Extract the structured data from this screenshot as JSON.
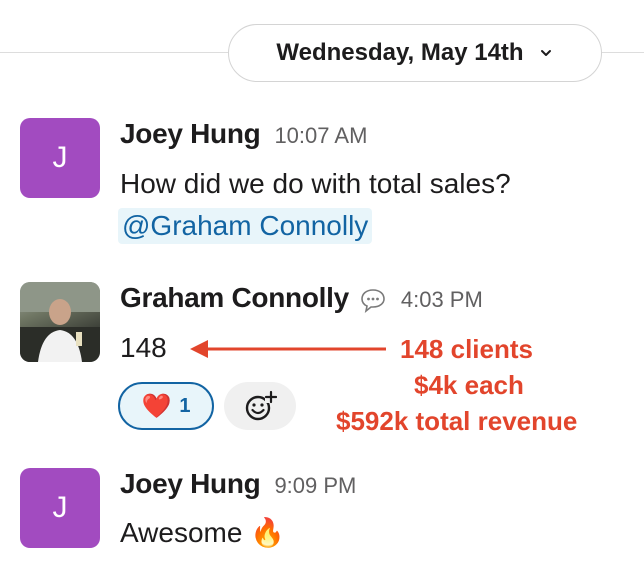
{
  "date_divider": {
    "label": "Wednesday, May 14th"
  },
  "messages": [
    {
      "sender": "Joey Hung",
      "time": "10:07 AM",
      "avatar_initial": "J",
      "text": "How did we do with total sales?",
      "mention": "@Graham Connolly"
    },
    {
      "sender": "Graham Connolly",
      "time": "4:03 PM",
      "text": "148",
      "reaction": {
        "emoji": "❤️",
        "count": "1"
      }
    },
    {
      "sender": "Joey Hung",
      "time": "9:09 PM",
      "avatar_initial": "J",
      "text": "Awesome 🔥"
    }
  ],
  "annotation": {
    "line1": "148 clients",
    "line2": "$4k each",
    "line3": "$592k total revenue",
    "color": "#e2452c"
  },
  "colors": {
    "avatar_purple": "#a24bc0",
    "mention_blue": "#1264a3",
    "mention_bg": "#e8f5fa"
  }
}
